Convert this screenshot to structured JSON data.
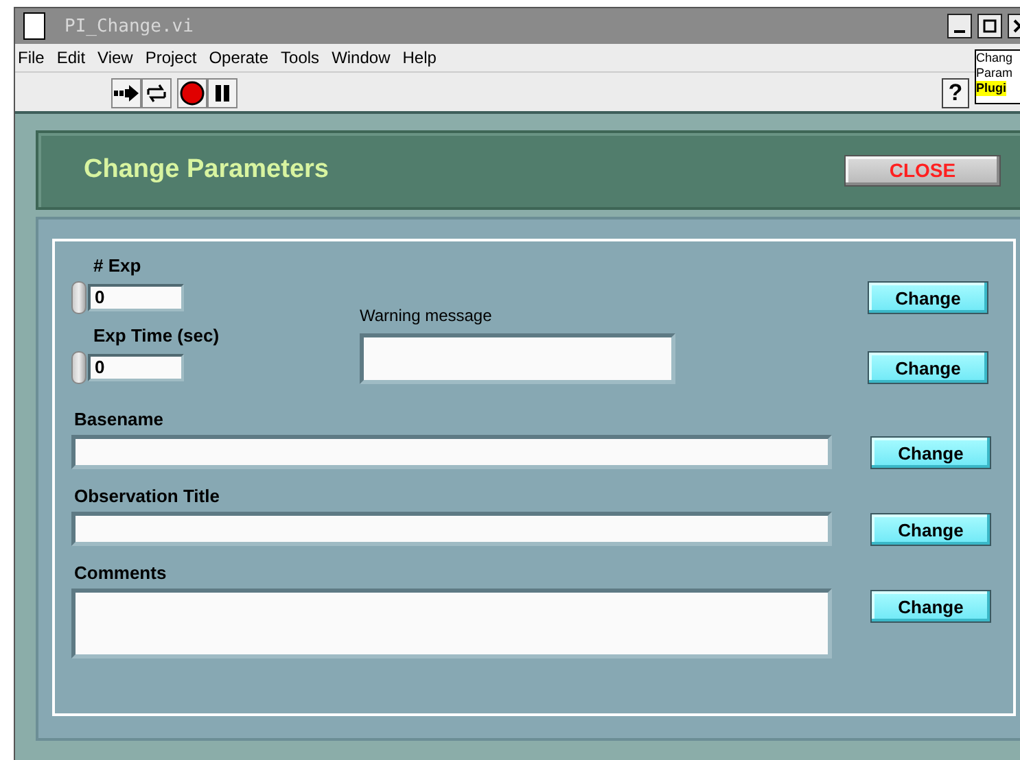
{
  "window": {
    "title": "PI_Change.vi"
  },
  "menu": [
    "File",
    "Edit",
    "View",
    "Project",
    "Operate",
    "Tools",
    "Window",
    "Help"
  ],
  "toolbar": {
    "help": "?"
  },
  "side_panel": {
    "lines": [
      {
        "text": "Chang",
        "highlight": false
      },
      {
        "text": "Param",
        "highlight": false
      },
      {
        "text": "Plugi",
        "highlight": true
      }
    ]
  },
  "header": {
    "title": "Change Parameters",
    "close_button": "CLOSE"
  },
  "numerics": [
    {
      "label": "# Exp",
      "value": "0",
      "button": "Change"
    },
    {
      "label": "Exp Time (sec)",
      "value": "0",
      "button": "Change"
    }
  ],
  "warning": {
    "label": "Warning message"
  },
  "text_fields": [
    {
      "label": "Basename",
      "kind": "line",
      "button": "Change"
    },
    {
      "label": "Observation Title",
      "kind": "line",
      "button": "Change"
    },
    {
      "label": "Comments",
      "kind": "area",
      "button": "Change"
    }
  ]
}
